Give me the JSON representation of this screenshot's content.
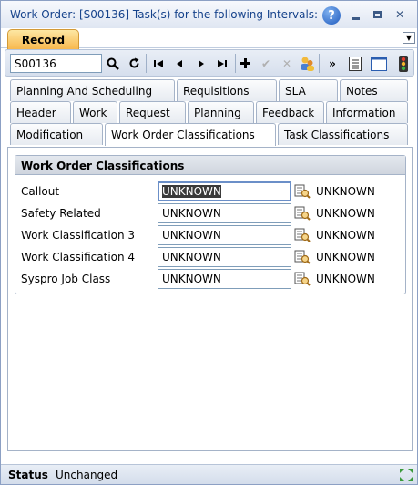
{
  "window": {
    "title": "Work Order: [S00136] Task(s) for the following Intervals: '"
  },
  "record_tab": {
    "label": "Record"
  },
  "toolbar": {
    "search_value": "S00136"
  },
  "tabs": {
    "row1": [
      "Planning And Scheduling",
      "Requisitions",
      "SLA",
      "Notes"
    ],
    "row2": [
      "Header",
      "Work",
      "Request",
      "Planning",
      "Feedback",
      "Information"
    ],
    "row3": [
      "Modification",
      "Work Order Classifications",
      "Task Classifications"
    ]
  },
  "group": {
    "title": "Work Order Classifications",
    "rows": [
      {
        "label": "Callout",
        "value": "UNKNOWN",
        "description": "UNKNOWN"
      },
      {
        "label": "Safety Related",
        "value": "UNKNOWN",
        "description": "UNKNOWN"
      },
      {
        "label": "Work Classification 3",
        "value": "UNKNOWN",
        "description": "UNKNOWN"
      },
      {
        "label": "Work Classification 4",
        "value": "UNKNOWN",
        "description": "UNKNOWN"
      },
      {
        "label": "Syspro Job Class",
        "value": "UNKNOWN",
        "description": "UNKNOWN"
      }
    ]
  },
  "status": {
    "label": "Status",
    "value": "Unchanged"
  },
  "colors": {
    "accent_tab": "#f8b84e",
    "title_text": "#15428b",
    "border": "#a5b3c8"
  }
}
